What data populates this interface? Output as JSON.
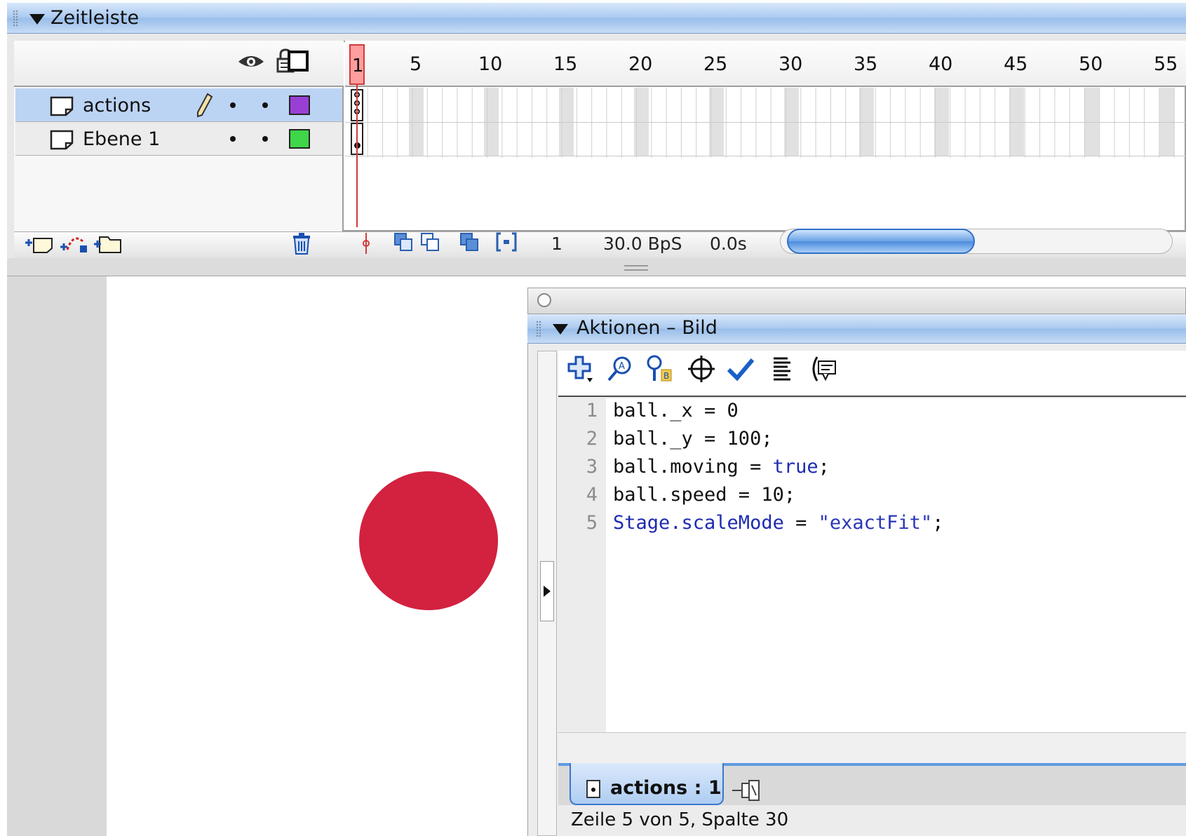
{
  "timeline": {
    "title": "Zeitleiste",
    "frame_numbers": [
      "1",
      "5",
      "10",
      "15",
      "20",
      "25",
      "30",
      "35",
      "40",
      "45",
      "50",
      "55"
    ],
    "layers": [
      {
        "name": "actions",
        "color": "#9a3fd6",
        "active": true
      },
      {
        "name": "Ebene 1",
        "color": "#3fd64a",
        "active": false
      }
    ],
    "footer": {
      "current_frame": "1",
      "frame_rate": "30.0 BpS",
      "elapsed_time": "0.0s"
    }
  },
  "stage": {
    "ball_color": "#d32140"
  },
  "actions_panel": {
    "title": "Aktionen – Bild",
    "code_lines": [
      {
        "num": "1",
        "text": "ball._x = 0"
      },
      {
        "num": "2",
        "text": "ball._y = 100;"
      },
      {
        "num": "3",
        "prefix": "ball.moving = ",
        "kw": "true",
        "suffix": ";"
      },
      {
        "num": "4",
        "text": "ball.speed = 10;"
      },
      {
        "num": "5",
        "kw": "Stage.scaleMode",
        "mid": " = ",
        "str": "\"exactFit\"",
        "suffix": ";"
      }
    ],
    "script_tab_label": "actions : 1",
    "status_text": "Zeile 5 von 5, Spalte 30"
  }
}
